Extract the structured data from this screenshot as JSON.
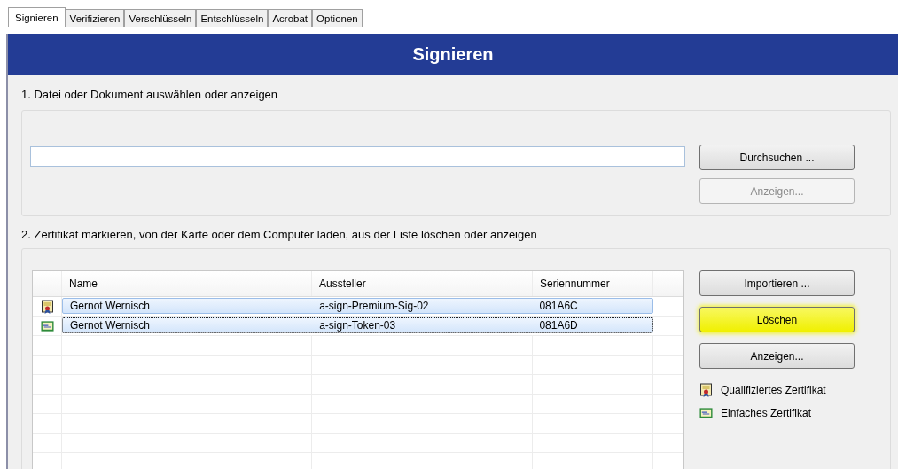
{
  "tabs": [
    {
      "label": "Signieren",
      "selected": true
    },
    {
      "label": "Verifizieren",
      "selected": false
    },
    {
      "label": "Verschlüsseln",
      "selected": false
    },
    {
      "label": "Entschlüsseln",
      "selected": false
    },
    {
      "label": "Acrobat",
      "selected": false
    },
    {
      "label": "Optionen",
      "selected": false
    }
  ],
  "banner": {
    "title": "Signieren"
  },
  "section_1": {
    "heading": "1. Datei oder Dokument auswählen oder anzeigen",
    "buttons": [
      {
        "label": "Durchsuchen ...",
        "disabled": false
      },
      {
        "label": "Anzeigen...",
        "disabled": true
      }
    ]
  },
  "section_2": {
    "heading": "2. Zertifikat markieren, von der Karte oder dem Computer laden, aus der Liste löschen oder anzeigen",
    "table": {
      "columns": [
        "Name",
        "Aussteller",
        "Seriennummer"
      ],
      "rows": [
        {
          "kind": "qualified",
          "name": "Gernot Wernisch",
          "issuer": "a-sign-Premium-Sig-02",
          "serial": "081A6C",
          "selected": true,
          "focused": false
        },
        {
          "kind": "simple",
          "name": "Gernot Wernisch",
          "issuer": "a-sign-Token-03",
          "serial": "081A6D",
          "selected": true,
          "focused": true
        }
      ]
    },
    "buttons": [
      {
        "label": "Importieren ...",
        "highlighted": false
      },
      {
        "label": "Löschen",
        "highlighted": true
      },
      {
        "label": "Anzeigen...",
        "highlighted": false
      }
    ],
    "legend": [
      {
        "kind": "qualified",
        "label": "Qualifiziertes Zertifikat"
      },
      {
        "kind": "simple",
        "label": "Einfaches Zertifikat"
      }
    ]
  }
}
